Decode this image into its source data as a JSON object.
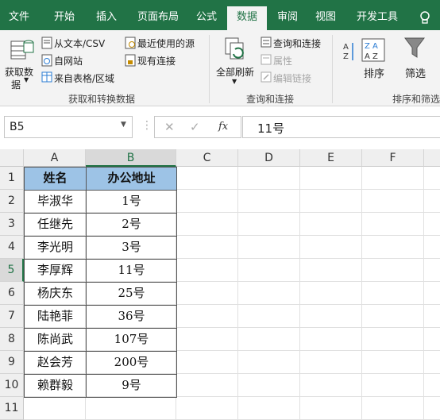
{
  "tabs": [
    "文件",
    "开始",
    "插入",
    "页面布局",
    "公式",
    "数据",
    "审阅",
    "视图",
    "开发工具"
  ],
  "ribbon": {
    "get_data": "获取数",
    "get_data2": "据",
    "from_text": "从文本/CSV",
    "from_web": "自网站",
    "from_table": "来自表格/区域",
    "recent_sources": "最近使用的源",
    "existing_conn": "现有连接",
    "refresh_all": "全部刷新",
    "queries_conn": "查询和连接",
    "properties": "属性",
    "edit_links": "编辑链接",
    "sort": "排序",
    "filter": "筛选",
    "group1": "获取和转换数据",
    "group2": "查询和连接",
    "group3": "排序和筛选"
  },
  "formula_bar": {
    "name_box": "B5",
    "fx": "fx",
    "content": "11号"
  },
  "columns": [
    "A",
    "B",
    "C",
    "D",
    "E",
    "F"
  ],
  "rows": [
    "1",
    "2",
    "3",
    "4",
    "5",
    "6",
    "7",
    "8",
    "9",
    "10",
    "11"
  ],
  "table": {
    "headers": [
      "姓名",
      "办公地址"
    ],
    "rows": [
      [
        "毕淑华",
        "1号"
      ],
      [
        "任继先",
        "2号"
      ],
      [
        "李光明",
        "3号"
      ],
      [
        "李厚辉",
        "11号"
      ],
      [
        "杨庆东",
        "25号"
      ],
      [
        "陆艳菲",
        "36号"
      ],
      [
        "陈尚武",
        "107号"
      ],
      [
        "赵会芳",
        "200号"
      ],
      [
        "赖群毅",
        "9号"
      ]
    ]
  },
  "colors": {
    "ribbon_green": "#217346",
    "header_fill": "#9dc3e6"
  }
}
